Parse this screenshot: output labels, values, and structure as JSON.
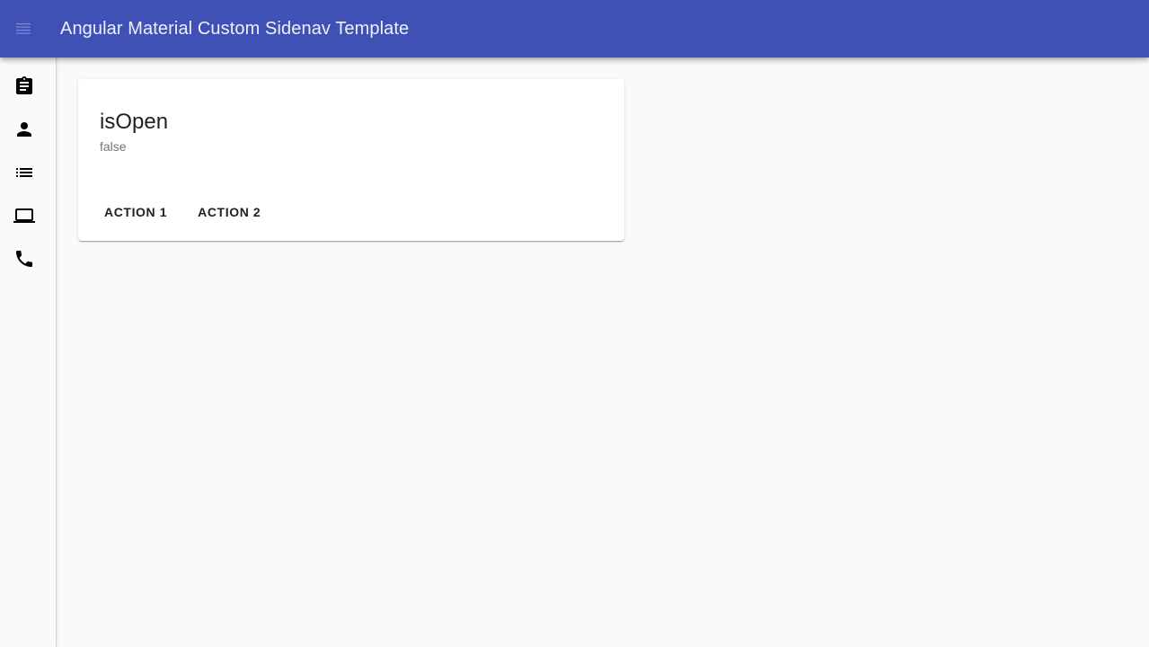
{
  "toolbar": {
    "title": "Angular Material Custom Sidenav Template",
    "menu_icon": "menu-icon",
    "background": "#3f51b5"
  },
  "sidenav": {
    "items": [
      {
        "icon": "assignment-icon"
      },
      {
        "icon": "person-icon"
      },
      {
        "icon": "list-icon"
      },
      {
        "icon": "laptop-icon"
      },
      {
        "icon": "phone-icon"
      }
    ]
  },
  "card": {
    "title": "isOpen",
    "subtitle": "false",
    "actions": [
      "ACTION 1",
      "ACTION 2"
    ]
  }
}
